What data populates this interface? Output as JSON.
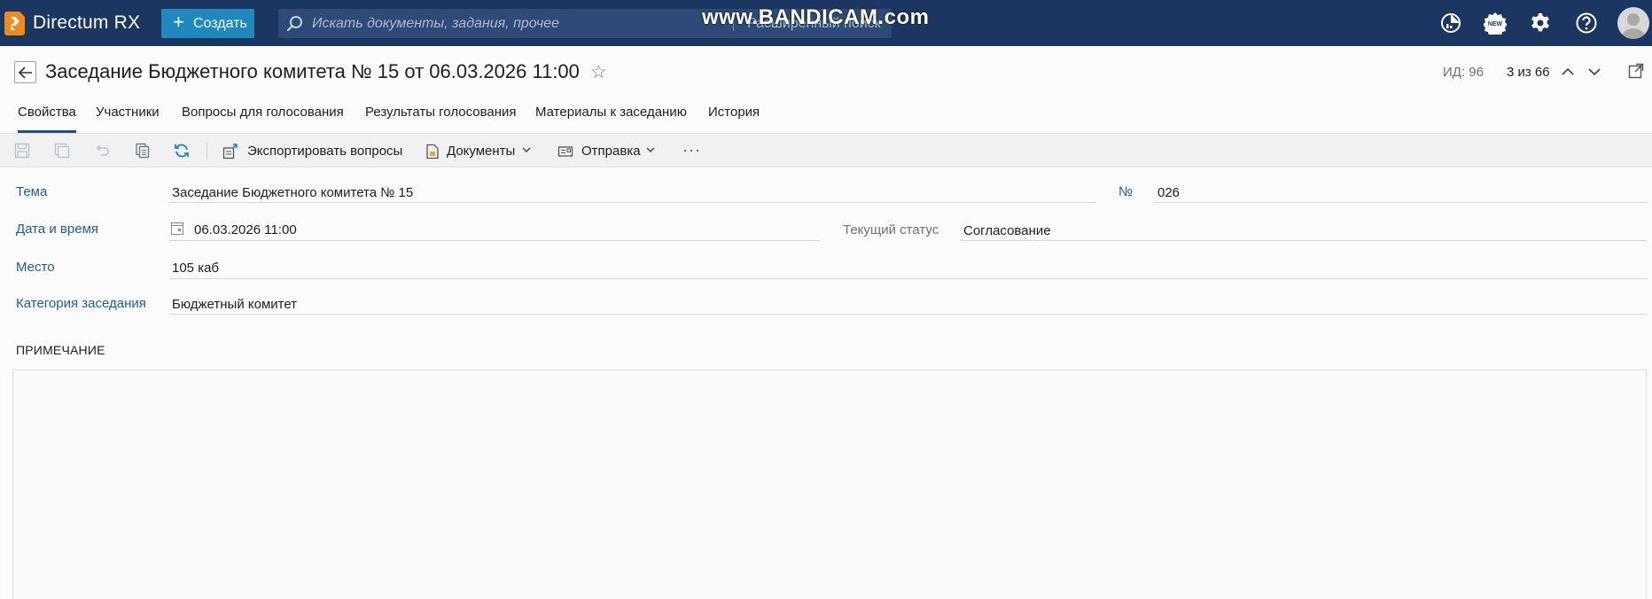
{
  "app": {
    "title": "Directum RX",
    "create_label": "Создать",
    "search_placeholder": "Искать документы, задания, прочее",
    "advanced_search": "Расширенный поиск",
    "watermark": "www.BANDICAM.com"
  },
  "header": {
    "title": "Заседание Бюджетного комитета № 15 от 06.03.2026 11:00",
    "id_label": "ИД: 96",
    "pager": "3 из 66"
  },
  "tabs": [
    {
      "label": "Свойства",
      "active": true
    },
    {
      "label": "Участники"
    },
    {
      "label": "Вопросы для голосования"
    },
    {
      "label": "Результаты голосования"
    },
    {
      "label": "Материалы к заседанию"
    },
    {
      "label": "История"
    }
  ],
  "toolbar": {
    "export_label": "Экспортировать вопросы",
    "documents_label": "Документы",
    "send_label": "Отправка",
    "more": "···"
  },
  "form": {
    "subject_label": "Тема",
    "subject_value": "Заседание Бюджетного комитета № 15",
    "number_label": "№",
    "number_value": "026",
    "datetime_label": "Дата и время",
    "datetime_value": "06.03.2026 11:00",
    "status_label": "Текущий статус",
    "status_value": "Согласование",
    "place_label": "Место",
    "place_value": "105 каб",
    "category_label": "Категория заседания",
    "category_value": "Бюджетный комитет",
    "note_title": "ПРИМЕЧАНИЕ",
    "note_value": ""
  },
  "colors": {
    "topbar": "#1b3761",
    "create_button": "#1f88bd",
    "label_blue": "#1c5c9e",
    "logo_orange": "#f08a1c"
  }
}
